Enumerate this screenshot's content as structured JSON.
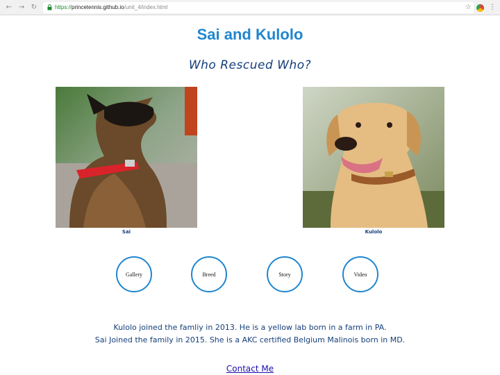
{
  "browser": {
    "url_secure": "https://",
    "url_domain": "princetennis.github.io",
    "url_path": "/unit_4/index.html",
    "icons": [
      "back-icon",
      "forward-icon",
      "reload-icon",
      "lock-icon",
      "star-icon",
      "extension-icon",
      "menu-icon"
    ]
  },
  "page": {
    "title": "Sai and Kulolo",
    "subtitle": "Who Rescued Who?",
    "dogs": [
      {
        "name": "Sai"
      },
      {
        "name": "Kulolo"
      }
    ],
    "nav": [
      "Gallery",
      "Breed",
      "Story",
      "Video"
    ],
    "description": [
      "Kulolo joined the famliy in 2013. He is a yellow lab born in a farm in PA.",
      "Sai Joined the family in 2015. She is a AKC certified Belgium Malinois born in MD."
    ],
    "contact_label": "Contact Me"
  },
  "colors": {
    "title": "#1f86cf",
    "subtitle": "#143e7a",
    "circle_border": "#1f86cf",
    "link": "#1a0dab"
  }
}
